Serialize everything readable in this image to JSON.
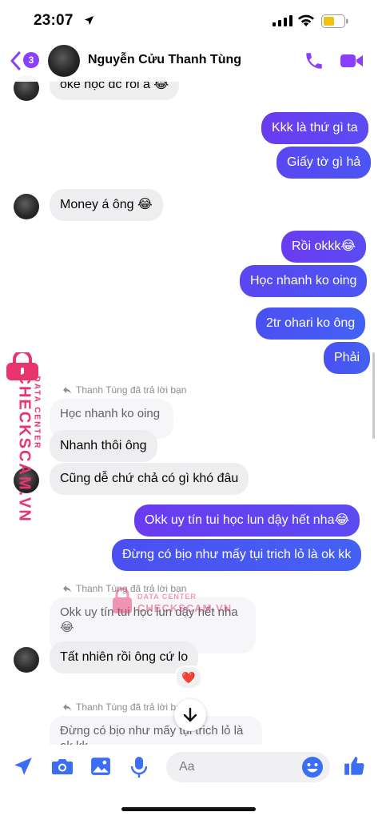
{
  "status_bar": {
    "time": "23:07"
  },
  "header": {
    "unread_count": "3",
    "contact_name": "Nguyễn Cửu Thanh Tùng"
  },
  "messages": [
    {
      "side": "in",
      "text": "oke học đc rồi á 😂"
    },
    {
      "side": "out",
      "text": "Kkk là thứ gì ta"
    },
    {
      "side": "out",
      "text": "Giấy tờ gì hả"
    },
    {
      "side": "in",
      "text": "Money á ông 😂"
    },
    {
      "side": "out",
      "text": "Rồi okkk😂"
    },
    {
      "side": "out",
      "text": "Học nhanh ko oing"
    },
    {
      "side": "out",
      "text": "2tr ohari ko ông"
    },
    {
      "side": "out",
      "text": "Phải"
    },
    {
      "side": "in",
      "reply_label": "Thanh Tùng đã trả lời bạn",
      "quoted": "Học nhanh ko oing",
      "text": "Nhanh thôi ông"
    },
    {
      "side": "in",
      "text": "Cũng dễ chứ chả có gì khó đâu"
    },
    {
      "side": "out",
      "text": "Okk uy tín tui học lun dậy hết nha😂"
    },
    {
      "side": "out",
      "text": "Đừng có bịo như mấy tụi trich lỏ là ok kk"
    },
    {
      "side": "in",
      "reply_label": "Thanh Tùng đã trả lời bạn",
      "quoted": "Okk uy tín tui học lun dậy hết nha 😂",
      "text": "Tất nhiên rồi ông cứ lo",
      "reaction": "❤️"
    },
    {
      "side": "in",
      "reply_label": "Thanh Tùng đã trả lời bạn",
      "quoted": "Đừng có bịo như mấy tụi trich lỏ là ok kk"
    }
  ],
  "watermark": {
    "line1": "DATA CENTER",
    "line2": "CHECKSCAM.VN"
  },
  "composer": {
    "placeholder": "Aa"
  },
  "colors": {
    "accent": "#8a3ffc",
    "outgoing": "#5b4bf2",
    "incoming": "#eeeef0",
    "watermark": "#e8356d"
  },
  "icons": [
    "location-arrow-icon",
    "signal-icon",
    "wifi-icon",
    "battery-icon",
    "back-chevron-icon",
    "phone-icon",
    "video-icon",
    "reply-icon",
    "send-location-icon",
    "camera-icon",
    "gallery-icon",
    "microphone-icon",
    "emoji-icon",
    "like-icon",
    "arrow-down-icon",
    "lock-icon"
  ]
}
